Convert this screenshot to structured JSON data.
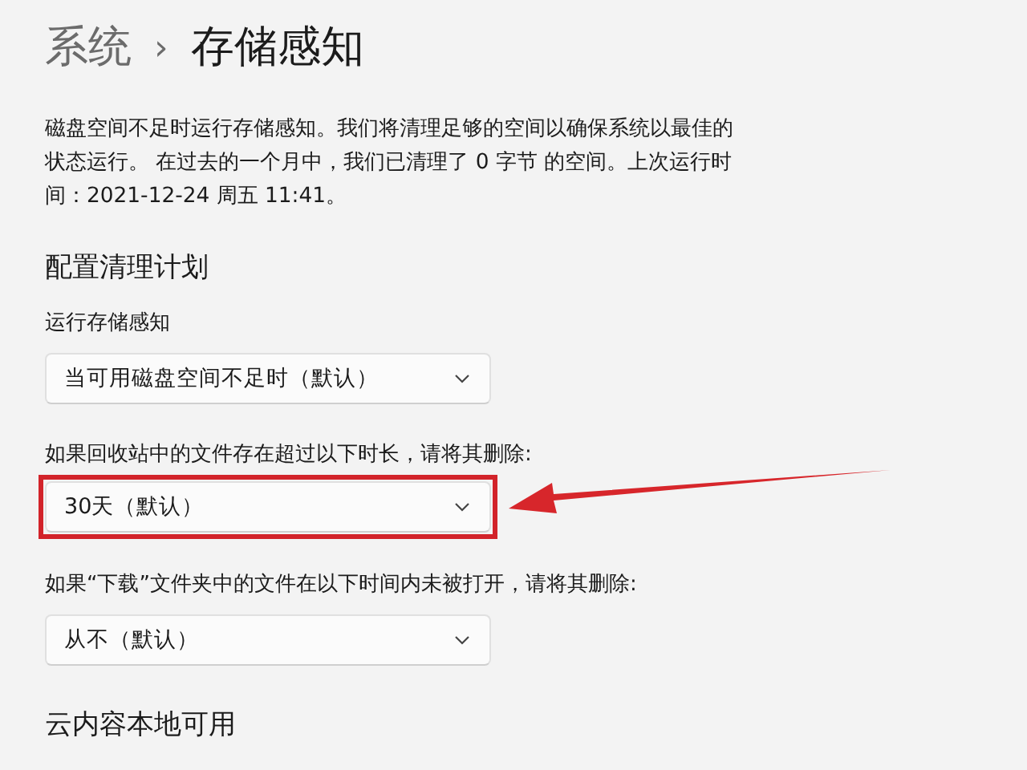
{
  "breadcrumb": [
    {
      "label": "系统",
      "current": false
    },
    {
      "label": "存储感知",
      "current": true
    }
  ],
  "breadcrumb_separator": "›",
  "description": "磁盘空间不足时运行存储感知。我们将清理足够的空间以确保系统以最佳的状态运行。 在过去的一个月中，我们已清理了 0 字节 的空间。上次运行时间：2021-12-24 周五 11:41。",
  "sections": [
    {
      "heading": "配置清理计划",
      "settings": [
        {
          "label": "运行存储感知",
          "value": "当可用磁盘空间不足时（默认）",
          "highlighted": false
        },
        {
          "label": "如果回收站中的文件存在超过以下时长，请将其删除:",
          "value": "30天（默认）",
          "highlighted": true
        },
        {
          "label": "如果“下载”文件夹中的文件在以下时间内未被打开，请将其删除:",
          "value": "从不（默认）",
          "highlighted": false
        }
      ]
    },
    {
      "heading": "云内容本地可用"
    }
  ]
}
